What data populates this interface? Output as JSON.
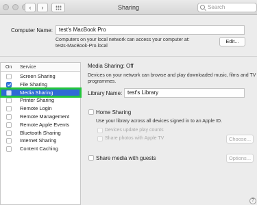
{
  "window": {
    "title": "Sharing"
  },
  "search": {
    "placeholder": "Search"
  },
  "computer": {
    "label": "Computer Name:",
    "value": "test's MacBook Pro",
    "note_line1": "Computers on your local network can access your computer at:",
    "note_line2": "tests-MacBook-Pro.local",
    "edit_label": "Edit..."
  },
  "services": {
    "header_on": "On",
    "header_service": "Service",
    "items": [
      {
        "label": "Screen Sharing",
        "checked": false
      },
      {
        "label": "File Sharing",
        "checked": true
      },
      {
        "label": "Media Sharing",
        "checked": false,
        "selected": true
      },
      {
        "label": "Printer Sharing",
        "checked": false
      },
      {
        "label": "Remote Login",
        "checked": false
      },
      {
        "label": "Remote Management",
        "checked": false
      },
      {
        "label": "Remote Apple Events",
        "checked": false
      },
      {
        "label": "Bluetooth Sharing",
        "checked": false
      },
      {
        "label": "Internet Sharing",
        "checked": false
      },
      {
        "label": "Content Caching",
        "checked": false
      }
    ]
  },
  "media": {
    "status": "Media Sharing: Off",
    "desc_line1": "Devices on your network can browse and play downloaded music, films and TV",
    "desc_line2": "programmes.",
    "library_label": "Library Name:",
    "library_value": "test's Library",
    "home_sharing": "Home Sharing",
    "home_desc": "Use your library across all devices signed in to an Apple ID.",
    "devices_counts": "Devices update play counts",
    "share_photos": "Share photos with Apple TV",
    "choose_label": "Choose...",
    "share_guests": "Share media with guests",
    "options_label": "Options..."
  },
  "help": {
    "label": "?"
  }
}
